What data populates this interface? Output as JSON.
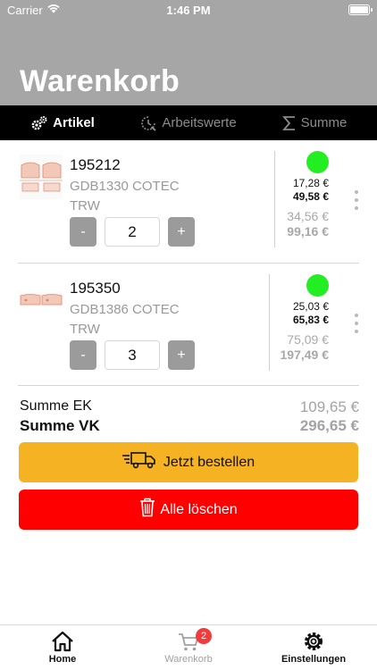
{
  "status_bar": {
    "carrier": "Carrier",
    "time": "1:46 PM"
  },
  "header": {
    "title": "Warenkorb"
  },
  "tabs": [
    {
      "label": "Artikel",
      "icon": "gears-icon",
      "active": true
    },
    {
      "label": "Arbeitswerte",
      "icon": "clock-wrench-icon",
      "active": false
    },
    {
      "label": "Summe",
      "icon": "sigma-icon",
      "active": false
    }
  ],
  "items": [
    {
      "number": "195212",
      "description": "GDB1330 COTEC",
      "brand": "TRW",
      "quantity": "2",
      "minus": "-",
      "plus": "+",
      "availability": "available",
      "ek_unit": "17,28 €",
      "vk_unit": "49,58 €",
      "ek_total": "34,56 €",
      "vk_total": "99,16 €"
    },
    {
      "number": "195350",
      "description": "GDB1386 COTEC",
      "brand": "TRW",
      "quantity": "3",
      "minus": "-",
      "plus": "+",
      "availability": "available",
      "ek_unit": "25,03 €",
      "vk_unit": "65,83 €",
      "ek_total": "75,09 €",
      "vk_total": "197,49 €"
    }
  ],
  "summary": {
    "ek_label": "Summe EK",
    "ek_value": "109,65 €",
    "vk_label": "Summe VK",
    "vk_value": "296,65 €"
  },
  "actions": {
    "order_label": "Jetzt bestellen",
    "delete_label": "Alle löschen"
  },
  "bottom_tabs": {
    "home": "Home",
    "cart": "Warenkorb",
    "cart_badge": "2",
    "settings": "Einstellungen"
  },
  "colors": {
    "header_grey": "#a6a6a6",
    "order_yellow": "#f5b324",
    "delete_red": "#ff0000",
    "availability_green": "#22ee22",
    "badge_red": "#f03c3c"
  }
}
